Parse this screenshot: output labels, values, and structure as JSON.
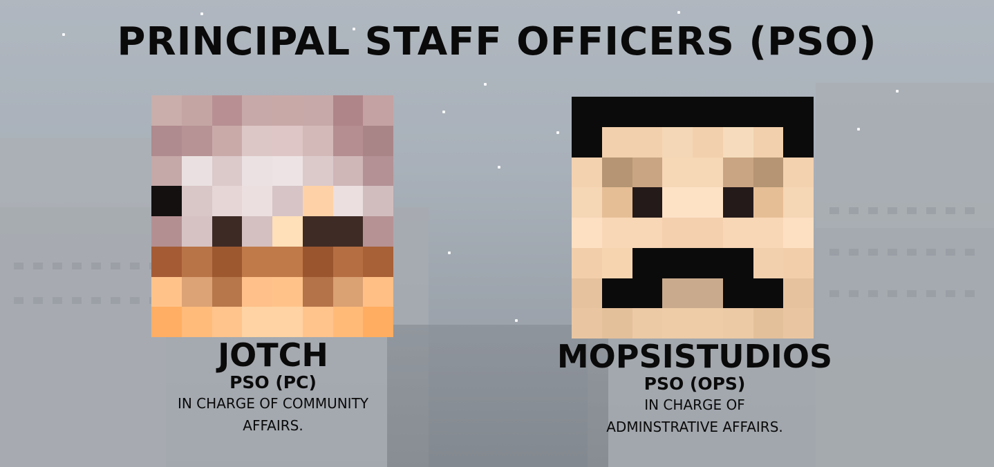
{
  "title": "PRINCIPAL STAFF OFFICERS (PSO)",
  "officers": [
    {
      "name": "JOTCH",
      "role": "PSO (PC)",
      "desc_line1": "IN CHARGE OF COMMUNITY",
      "desc_line2": "AFFAIRS.",
      "avatar_icon": "player-head-icon"
    },
    {
      "name": "MOPSISTUDIOS",
      "role": "PSO (OPS)",
      "desc_line1": "IN CHARGE OF",
      "desc_line2": "ADMINSTRATIVE AFFAIRS.",
      "avatar_icon": "player-head-icon"
    }
  ],
  "colors": {
    "text": "#0a0a0a",
    "left_face": [
      [
        "#c9aeab",
        "#c4a5a4",
        "#b89093",
        "#c7a9a9",
        "#c9a9a8",
        "#c7a9a9",
        "#b08589",
        "#c4a2a3"
      ],
      [
        "#af8a8e",
        "#b89396",
        "#c9aaa9",
        "#ddc7c6",
        "#ddc6c5",
        "#d4b9b9",
        "#b48e91",
        "#aa8588"
      ],
      [
        "#c5a8a8",
        "#eae0e1",
        "#dcc9ca",
        "#ebe1e2",
        "#ede3e4",
        "#dccacb",
        "#cfb6b7",
        "#b39195"
      ],
      [
        "#141010",
        "#d9c6c6",
        "#e6d6d6",
        "#ebdfe0",
        "#d7c4c6",
        "#fed2a6",
        "#ebdfe0",
        "#d2bdbe"
      ],
      [
        "#b48f92",
        "#d6c2c3",
        "#3d2a25",
        "#d4c0c1",
        "#ffe0b8",
        "#3f2b26",
        "#3f2b26",
        "#b69294"
      ],
      [
        "#a55c35",
        "#b87346",
        "#9d5830",
        "#c07a4a",
        "#c07a4a",
        "#9a552e",
        "#b56e42",
        "#a86036"
      ],
      [
        "#ffc38a",
        "#dca376",
        "#b7774a",
        "#ffc08a",
        "#ffc38a",
        "#b47349",
        "#daa173",
        "#ffbf85"
      ],
      [
        "#ffae63",
        "#ffbb7a",
        "#ffc48c",
        "#ffd3a3",
        "#ffd3a3",
        "#ffc48c",
        "#ffba78",
        "#ffad60"
      ]
    ],
    "right_face": [
      [
        "#0b0b0b",
        "#0b0b0b",
        "#0b0b0b",
        "#0b0b0b",
        "#0b0b0b",
        "#0b0b0b",
        "#0b0b0b",
        "#0b0b0b"
      ],
      [
        "#0b0b0b",
        "#f2d0ad",
        "#f2d0ad",
        "#f4d7b6",
        "#f2d0ad",
        "#f6dcbc",
        "#f2d0ad",
        "#0b0b0b"
      ],
      [
        "#f3d2af",
        "#b59573",
        "#caa583",
        "#f6d7b6",
        "#f6d7b6",
        "#caa583",
        "#b59573",
        "#f3d2af"
      ],
      [
        "#f5d6b5",
        "#e6be96",
        "#241a1a",
        "#fde2c6",
        "#fde2c6",
        "#241a1a",
        "#e6be96",
        "#f5d6b5"
      ],
      [
        "#fde0c2",
        "#f8d7b6",
        "#f8d7b6",
        "#f4d0ae",
        "#f4d0ae",
        "#f8d7b6",
        "#f8d7b6",
        "#fde0c2"
      ],
      [
        "#f2cfaa",
        "#f6d4b0",
        "#0b0b0b",
        "#0b0b0b",
        "#0b0b0b",
        "#0b0b0b",
        "#f2cfad",
        "#f2cfaa"
      ],
      [
        "#e6c29e",
        "#0b0b0b",
        "#0b0b0b",
        "#c9aa8c",
        "#c9aa8c",
        "#0b0b0b",
        "#0b0b0b",
        "#e6c29e"
      ],
      [
        "#e9c6a1",
        "#e4c09a",
        "#eccaa5",
        "#eecca7",
        "#eecca7",
        "#eccaa5",
        "#e4c09a",
        "#e9c6a1"
      ]
    ]
  }
}
